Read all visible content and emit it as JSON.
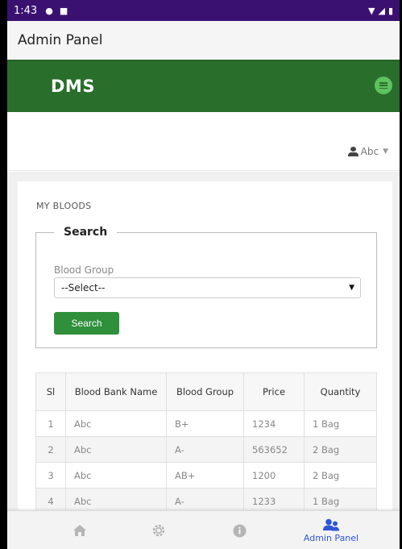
{
  "status_bar": {
    "time": "1:43"
  },
  "app_bar": {
    "title": "Admin Panel"
  },
  "header": {
    "brand": "DMS"
  },
  "user_menu": {
    "name": "Abc"
  },
  "panel": {
    "title": "MY BLOODS",
    "search": {
      "legend": "Search",
      "blood_group_label": "Blood Group",
      "select_value": "--Select--",
      "button_label": "Search"
    }
  },
  "table": {
    "headers": [
      "Sl",
      "Blood Bank Name",
      "Blood Group",
      "Price",
      "Quantity"
    ],
    "rows": [
      [
        "1",
        "Abc",
        "B+",
        "1234",
        "1 Bag"
      ],
      [
        "2",
        "Abc",
        "A-",
        "563652",
        "2 Bag"
      ],
      [
        "3",
        "Abc",
        "AB+",
        "1200",
        "2 Bag"
      ],
      [
        "4",
        "Abc",
        "A-",
        "1233",
        "1 Bag"
      ]
    ]
  },
  "bottom_nav": {
    "items": [
      {
        "icon": "home-icon"
      },
      {
        "icon": "settings-icon"
      },
      {
        "icon": "info-icon"
      },
      {
        "icon": "admin-panel-icon",
        "label": "Admin Panel",
        "active": true
      }
    ]
  },
  "colors": {
    "status_bar": "#3a1170",
    "header_green": "#2a6e2c",
    "button_green": "#2f8f3a",
    "active_nav": "#2d56d8"
  }
}
